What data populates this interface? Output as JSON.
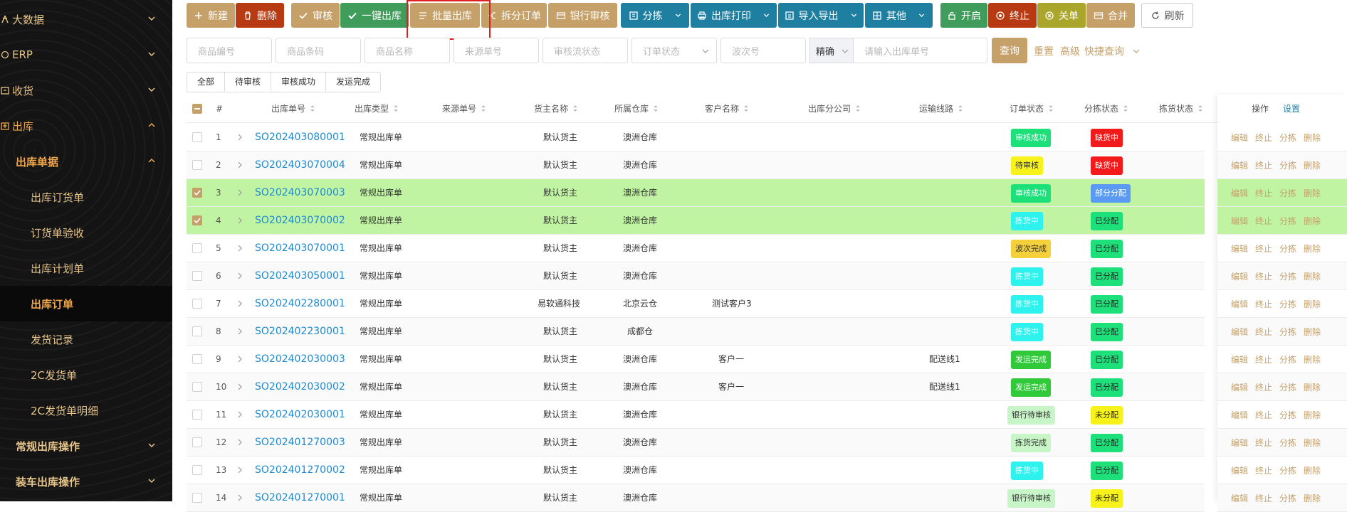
{
  "sidebar": {
    "items": [
      {
        "label": "大数据",
        "icon": "bigdata-icon"
      },
      {
        "label": "ERP",
        "icon": "erp-icon"
      },
      {
        "label": "收货",
        "icon": "receive-icon"
      },
      {
        "label": "出库",
        "icon": "outbound-icon"
      },
      {
        "label": "出库单据"
      },
      {
        "label": "出库订货单"
      },
      {
        "label": "订货单验收"
      },
      {
        "label": "出库计划单"
      },
      {
        "label": "出库订单"
      },
      {
        "label": "发货记录"
      },
      {
        "label": "2C发货单"
      },
      {
        "label": "2C发货单明细"
      },
      {
        "label": "常规出库操作"
      },
      {
        "label": "装车出库操作"
      }
    ]
  },
  "toolbar": {
    "new": "新建",
    "delete": "删除",
    "audit": "审核",
    "one_click": "一键出库",
    "batch": "批量出库",
    "split": "拆分订单",
    "bank_audit": "银行审核",
    "pick": "分拣",
    "print": "出库打印",
    "import_export": "导入导出",
    "other": "其他",
    "open": "开启",
    "terminate": "终止",
    "close": "关单",
    "merge": "合并",
    "refresh": "刷新"
  },
  "filters": {
    "product_code": "商品编号",
    "barcode": "商品条码",
    "product_name": "商品名称",
    "source_no": "来源单号",
    "audit_status": "审核流状态",
    "order_status": "订单状态",
    "wave_no": "波次号",
    "mode": "精确",
    "outbound_no": "请输入出库单号",
    "search": "查询",
    "reset": "重置",
    "advanced": "高级",
    "quick": "快捷查询"
  },
  "status_tabs": [
    "全部",
    "待审核",
    "审核成功",
    "发运完成"
  ],
  "table": {
    "headers": {
      "index": "#",
      "order_no": "出库单号",
      "type": "出库类型",
      "source_no": "来源单号",
      "owner": "货主名称",
      "warehouse": "所属仓库",
      "customer": "客户名称",
      "branch": "出库分公司",
      "route": "运输线路",
      "order_status": "订单状态",
      "pick_status": "分拣状态",
      "picking_status": "拣货状态",
      "ops": "操作",
      "settings": "设置"
    },
    "rows": [
      {
        "no": "1",
        "order": "SO202403080001",
        "type": "常规出库单",
        "owner": "默认货主",
        "wh": "澳洲仓库",
        "customer": "",
        "route": "",
        "status": "审核成功",
        "status_color": "#1ee07a",
        "pick": "缺货中",
        "pick_color": "#f21a1a",
        "pick_text": "#ffffff",
        "checked": false
      },
      {
        "no": "2",
        "order": "SO202403070004",
        "type": "常规出库单",
        "owner": "默认货主",
        "wh": "澳洲仓库",
        "customer": "",
        "route": "",
        "status": "待审核",
        "status_color": "#f7f21a",
        "pick": "缺货中",
        "pick_color": "#f21a1a",
        "pick_text": "#ffffff",
        "checked": false
      },
      {
        "no": "3",
        "order": "SO202403070003",
        "type": "常规出库单",
        "owner": "默认货主",
        "wh": "澳洲仓库",
        "customer": "",
        "route": "",
        "status": "审核成功",
        "status_color": "#1ee07a",
        "pick": "部分分配",
        "pick_color": "#5a9af2",
        "pick_text": "#ffffff",
        "checked": true
      },
      {
        "no": "4",
        "order": "SO202403070002",
        "type": "常规出库单",
        "owner": "默认货主",
        "wh": "澳洲仓库",
        "customer": "",
        "route": "",
        "status": "拣货中",
        "status_color": "#2ef2ee",
        "pick": "已分配",
        "pick_color": "#1ee07a",
        "pick_text": "#222222",
        "checked": true
      },
      {
        "no": "5",
        "order": "SO202403070001",
        "type": "常规出库单",
        "owner": "默认货主",
        "wh": "澳洲仓库",
        "customer": "",
        "route": "",
        "status": "波次完成",
        "status_color": "#f5d03a",
        "pick": "已分配",
        "pick_color": "#1ee07a",
        "pick_text": "#222222",
        "checked": false
      },
      {
        "no": "6",
        "order": "SO202403050001",
        "type": "常规出库单",
        "owner": "默认货主",
        "wh": "澳洲仓库",
        "customer": "",
        "route": "",
        "status": "拣货中",
        "status_color": "#2ef2ee",
        "pick": "已分配",
        "pick_color": "#1ee07a",
        "pick_text": "#222222",
        "checked": false
      },
      {
        "no": "7",
        "order": "SO202402280001",
        "type": "常规出库单",
        "owner": "易软通科技",
        "wh": "北京云仓",
        "customer": "测试客户3",
        "route": "",
        "status": "拣货中",
        "status_color": "#2ef2ee",
        "pick": "已分配",
        "pick_color": "#1ee07a",
        "pick_text": "#222222",
        "checked": false
      },
      {
        "no": "8",
        "order": "SO202402230001",
        "type": "常规出库单",
        "owner": "默认货主",
        "wh": "成都仓",
        "customer": "",
        "route": "",
        "status": "拣货中",
        "status_color": "#2ef2ee",
        "pick": "已分配",
        "pick_color": "#1ee07a",
        "pick_text": "#222222",
        "checked": false
      },
      {
        "no": "9",
        "order": "SO202402030003",
        "type": "常规出库单",
        "owner": "默认货主",
        "wh": "澳洲仓库",
        "customer": "客户一",
        "route": "配送线1",
        "status": "发运完成",
        "status_color": "#2fc93a",
        "pick": "已分配",
        "pick_color": "#1ee07a",
        "pick_text": "#222222",
        "checked": false
      },
      {
        "no": "10",
        "order": "SO202402030002",
        "type": "常规出库单",
        "owner": "默认货主",
        "wh": "澳洲仓库",
        "customer": "客户一",
        "route": "配送线1",
        "status": "发运完成",
        "status_color": "#2fc93a",
        "pick": "已分配",
        "pick_color": "#1ee07a",
        "pick_text": "#222222",
        "checked": false
      },
      {
        "no": "11",
        "order": "SO202402030001",
        "type": "常规出库单",
        "owner": "默认货主",
        "wh": "澳洲仓库",
        "customer": "",
        "route": "",
        "status": "银行待审核",
        "status_color": "#c8f5c8",
        "pick": "未分配",
        "pick_color": "#f7f21a",
        "pick_text": "#222222",
        "checked": false
      },
      {
        "no": "12",
        "order": "SO202401270003",
        "type": "常规出库单",
        "owner": "默认货主",
        "wh": "澳洲仓库",
        "customer": "",
        "route": "",
        "status": "拣货完成",
        "status_color": "#c8f5c8",
        "pick": "已分配",
        "pick_color": "#1ee07a",
        "pick_text": "#222222",
        "checked": false
      },
      {
        "no": "13",
        "order": "SO202401270002",
        "type": "常规出库单",
        "owner": "默认货主",
        "wh": "澳洲仓库",
        "customer": "",
        "route": "",
        "status": "拣货中",
        "status_color": "#2ef2ee",
        "pick": "已分配",
        "pick_color": "#1ee07a",
        "pick_text": "#222222",
        "checked": false
      },
      {
        "no": "14",
        "order": "SO202401270001",
        "type": "常规出库单",
        "owner": "默认货主",
        "wh": "澳洲仓库",
        "customer": "",
        "route": "",
        "status": "银行待审核",
        "status_color": "#c8f5c8",
        "pick": "未分配",
        "pick_color": "#f7f21a",
        "pick_text": "#222222",
        "checked": false
      }
    ],
    "ops": [
      "编辑",
      "终止",
      "分拣",
      "删除"
    ]
  }
}
